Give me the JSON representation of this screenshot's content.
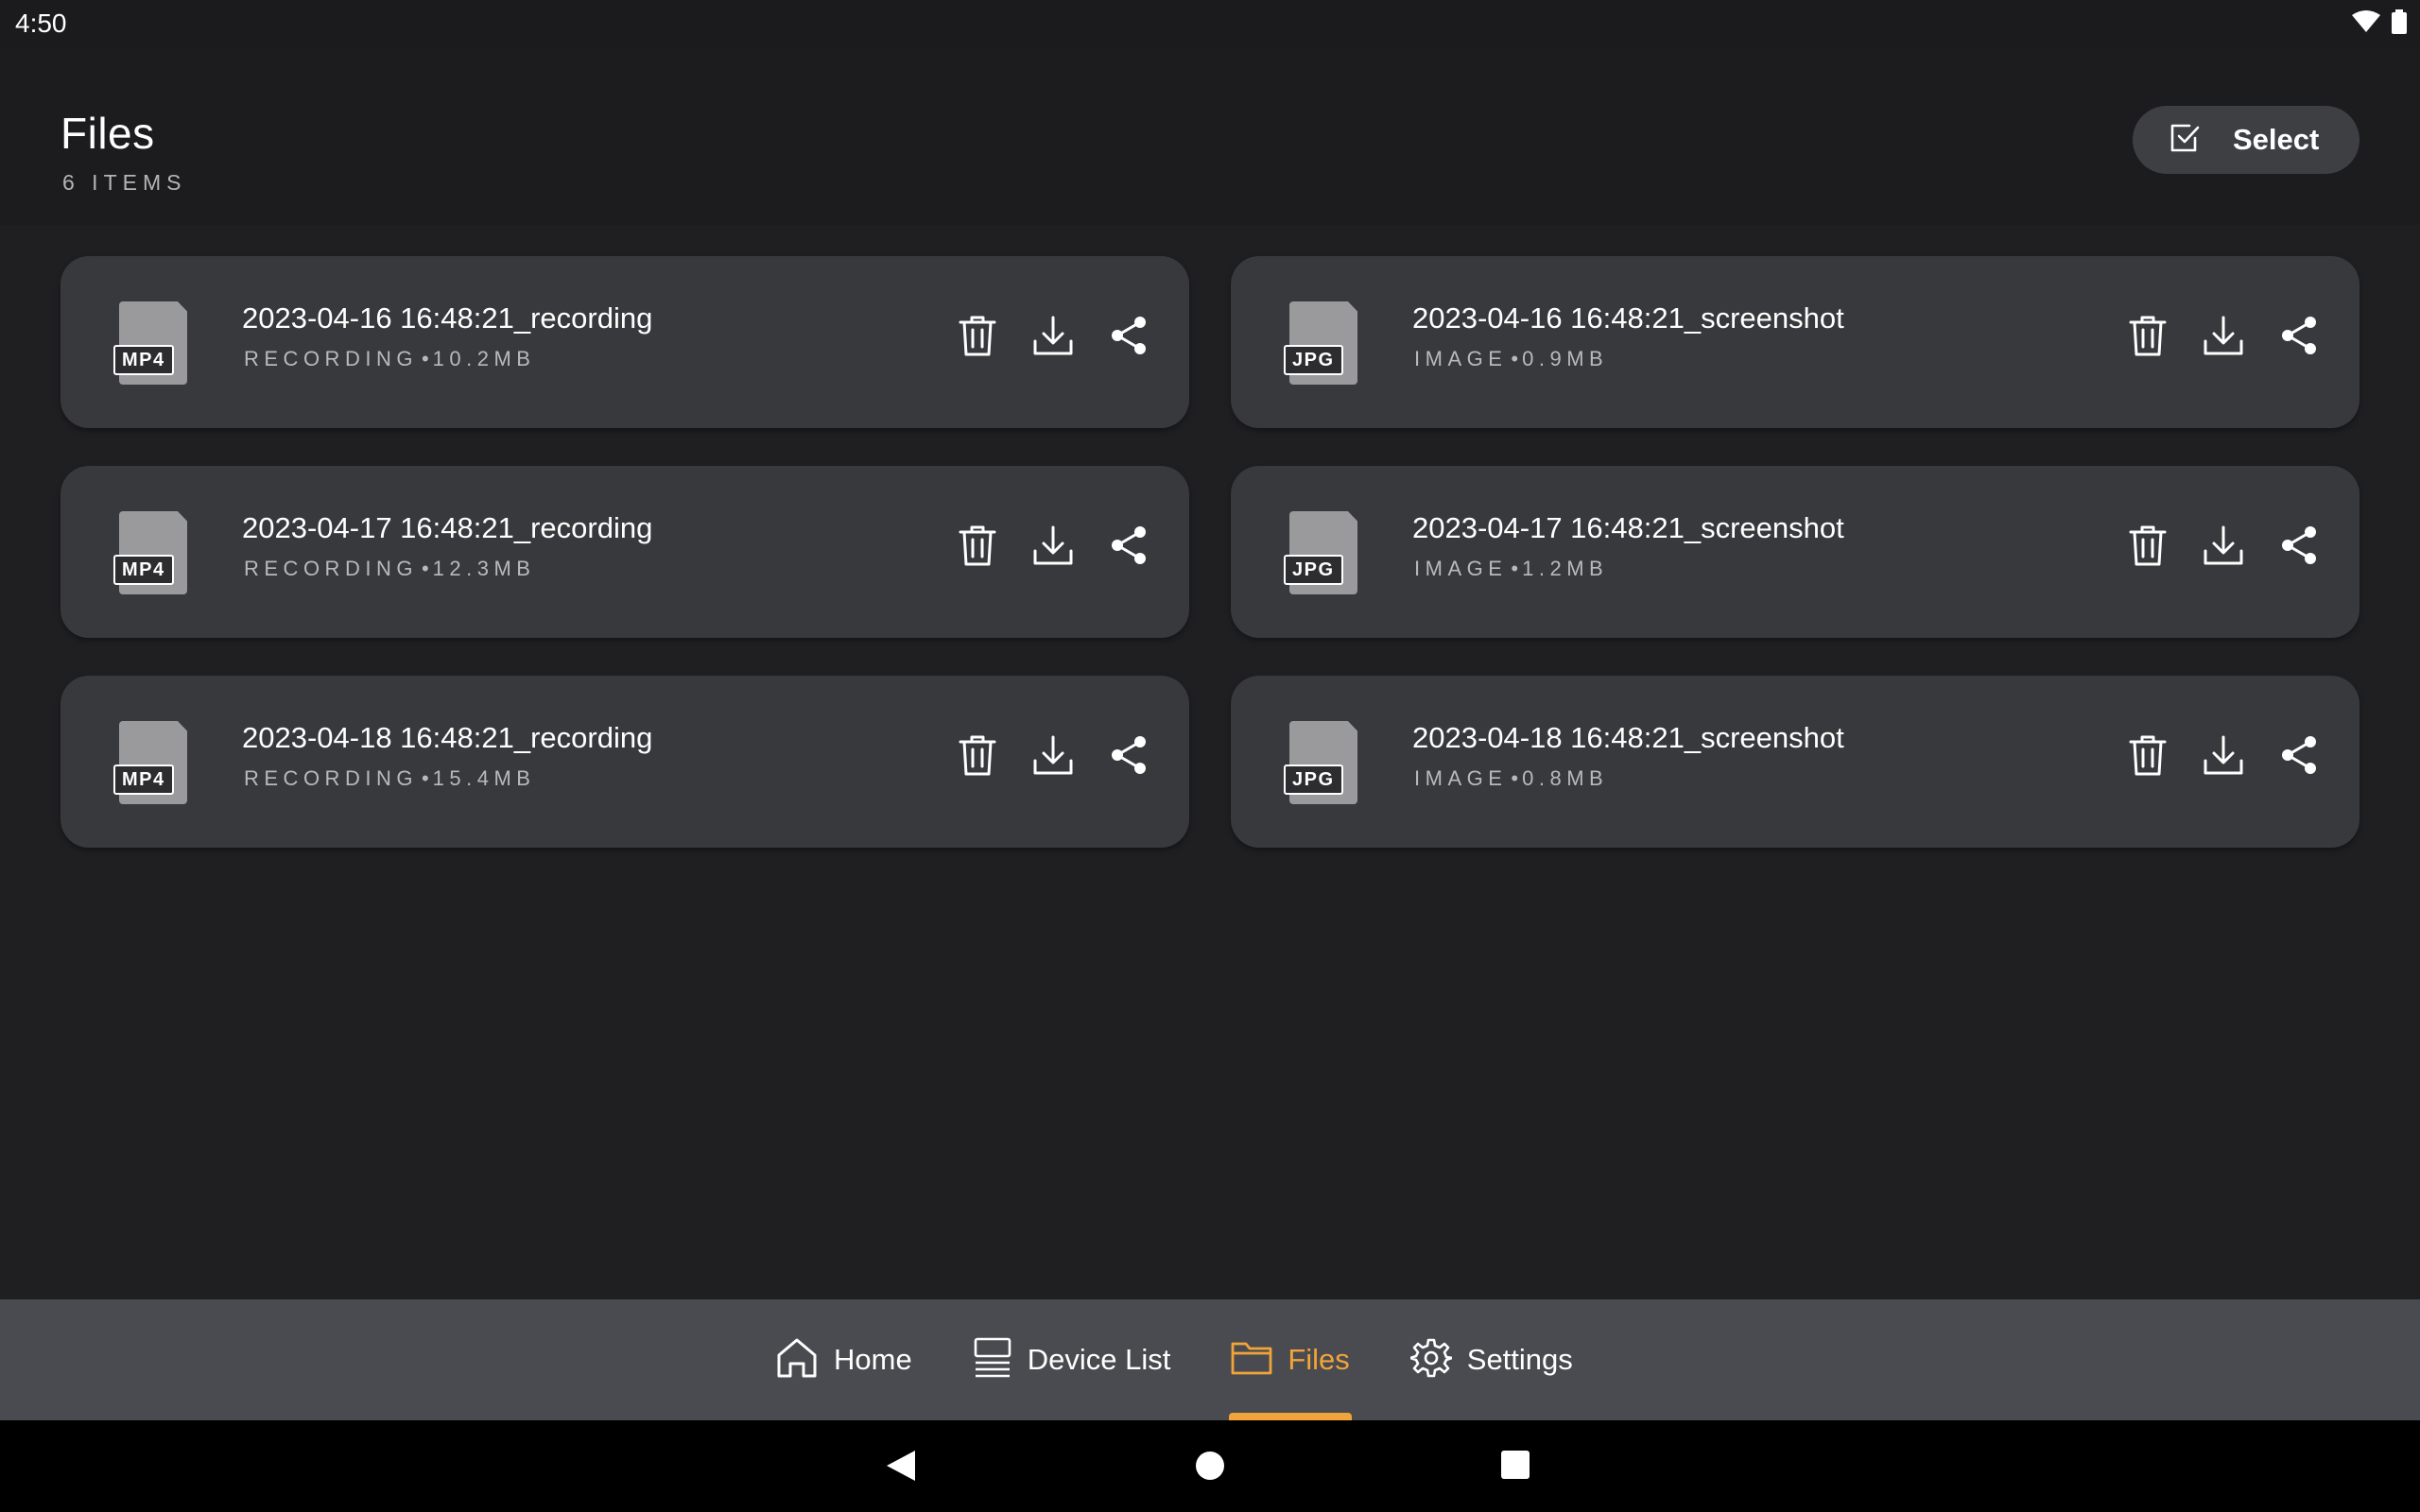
{
  "status_bar": {
    "time": "4:50",
    "icons": [
      "wifi-icon",
      "battery-icon"
    ]
  },
  "header": {
    "title": "Files",
    "count": "6 ITEMS",
    "select_label": "Select"
  },
  "files": [
    {
      "name": "2023-04-16 16:48:21_recording",
      "type_label": "RECORDING",
      "size": "10.2MB",
      "badge": "MP4"
    },
    {
      "name": "2023-04-16 16:48:21_screenshot",
      "type_label": "IMAGE",
      "size": "0.9MB",
      "badge": "JPG"
    },
    {
      "name": "2023-04-17 16:48:21_recording",
      "type_label": "RECORDING",
      "size": "12.3MB",
      "badge": "MP4"
    },
    {
      "name": "2023-04-17 16:48:21_screenshot",
      "type_label": "IMAGE",
      "size": "1.2MB",
      "badge": "JPG"
    },
    {
      "name": "2023-04-18 16:48:21_recording",
      "type_label": "RECORDING",
      "size": "15.4MB",
      "badge": "MP4"
    },
    {
      "name": "2023-04-18 16:48:21_screenshot",
      "type_label": "IMAGE",
      "size": "0.8MB",
      "badge": "JPG"
    }
  ],
  "separator": "•",
  "file_actions": [
    "trash-icon",
    "download-icon",
    "share-icon"
  ],
  "bottom_nav": {
    "items": [
      {
        "label": "Home",
        "icon": "home-icon",
        "active": false
      },
      {
        "label": "Device List",
        "icon": "device-list-icon",
        "active": false
      },
      {
        "label": "Files",
        "icon": "folder-icon",
        "active": true
      },
      {
        "label": "Settings",
        "icon": "gear-icon",
        "active": false
      }
    ]
  },
  "system_nav": [
    "back-icon",
    "home-circle-icon",
    "recents-icon"
  ],
  "colors": {
    "accent": "#f0a43a",
    "background": "#1f1f21",
    "card": "#38393c",
    "nav": "#4a4b50"
  }
}
